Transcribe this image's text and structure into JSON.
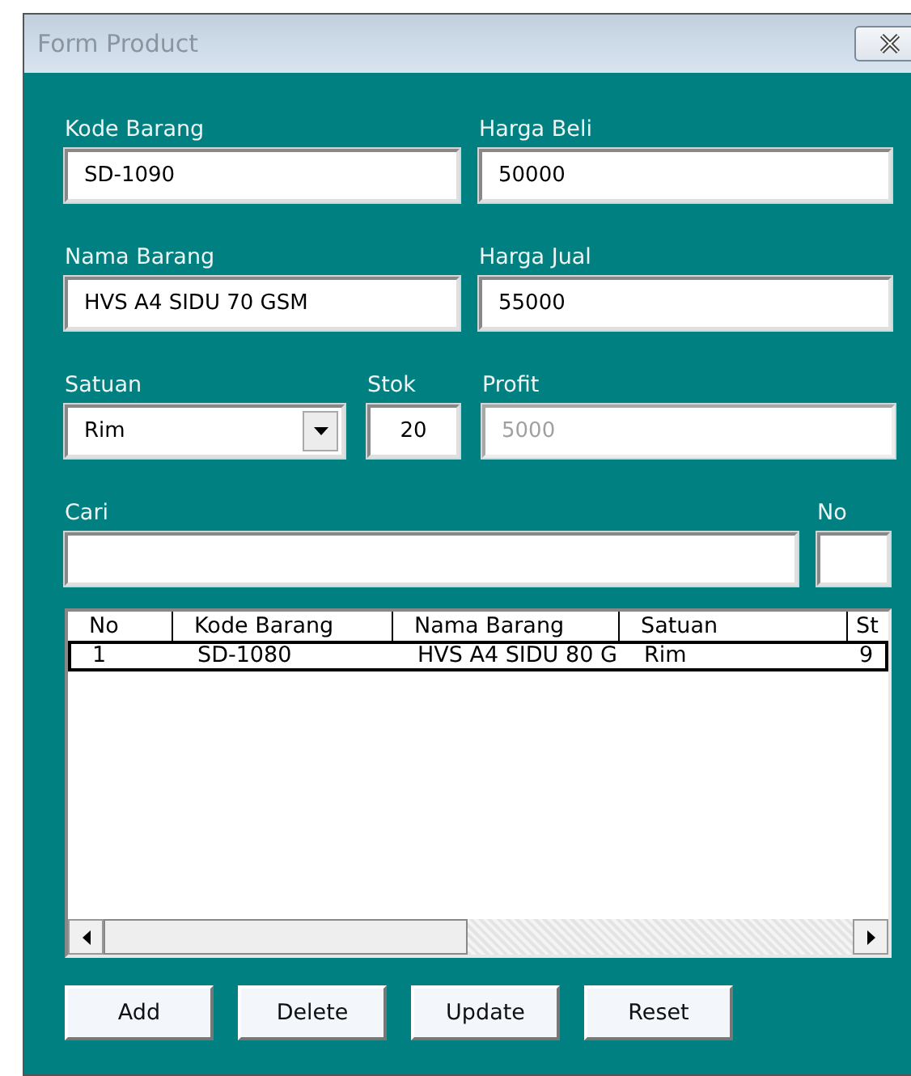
{
  "window": {
    "title": "Form Product"
  },
  "field_rows": [
    [
      {
        "label": "Kode Barang",
        "value": "SD-1090",
        "kind": "text",
        "disabled": false
      },
      {
        "label": "Harga Beli",
        "value": "50000",
        "kind": "text",
        "disabled": false
      }
    ],
    [
      {
        "label": "Nama Barang",
        "value": "HVS A4 SIDU 70 GSM",
        "kind": "text",
        "disabled": false
      },
      {
        "label": "Harga Jual",
        "value": "55000",
        "kind": "text",
        "disabled": false
      }
    ],
    [
      {
        "label": "Satuan",
        "value": "Rim",
        "kind": "combo",
        "disabled": false
      },
      {
        "label": "Stok",
        "value": "20",
        "kind": "number",
        "disabled": false
      },
      {
        "label": "Profit",
        "value": "5000",
        "kind": "text",
        "disabled": true
      }
    ],
    [
      {
        "label": "Cari",
        "kind": "text",
        "disabled": false
      },
      {
        "label": "No",
        "kind": "text",
        "disabled": false
      }
    ]
  ],
  "table": {
    "columns": [
      "No",
      "Kode Barang",
      "Nama Barang",
      "Satuan",
      "St"
    ],
    "rows": [
      {
        "cells": [
          "1",
          "SD-1080",
          "HVS A4 SIDU 80 G",
          "Rim",
          "9"
        ],
        "selected": true
      }
    ]
  },
  "buttons": [
    "Add",
    "Delete",
    "Update",
    "Reset"
  ]
}
